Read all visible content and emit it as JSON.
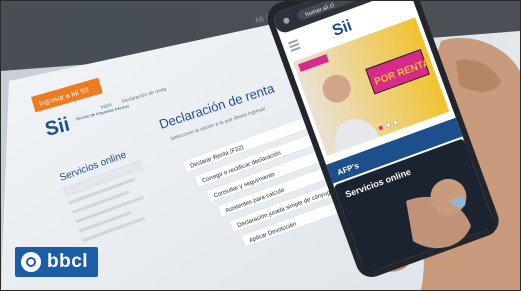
{
  "laptop": {
    "button_label": "Ingresar a Mi SII",
    "logo_text": "Sii",
    "logo_caption": "Servicio de Impuestos Internos",
    "breadcrumb_1": "Inicio",
    "breadcrumb_2": "Declaración de renta",
    "sidebar_title": "Servicios online",
    "heading": "Declaración de renta",
    "subheading": "Seleccione la opción a la que desea ingresar",
    "menu_items": [
      "Declarar Renta (F22)",
      "Corregir o rectificar declaración",
      "Consultar y seguimiento",
      "Asistentes para calculo",
      "Declaración jurada simple de cónyuge",
      "Aplicar Devolución"
    ],
    "tab_right": "Mi Si"
  },
  "phone": {
    "url": "homer.sii.cl",
    "logo_text": "Sii",
    "banner_text": "POR RENTA",
    "section_1": "AFP's",
    "section_2": "Servicios online"
  },
  "watermark": {
    "brand": "bbcl"
  },
  "colors": {
    "sii_orange": "#f07a20",
    "sii_blue": "#1d4f8c",
    "banner_yellow": "#f2c230",
    "banner_magenta": "#d72a8a",
    "phone_dark": "#22252b",
    "bbcl_blue": "#1b5ea8"
  }
}
